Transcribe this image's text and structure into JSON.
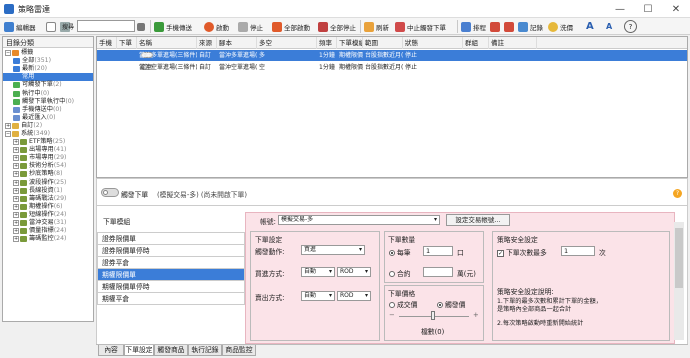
{
  "window": {
    "title": "策略雷達",
    "min": "—",
    "max": "☐",
    "close": "✕"
  },
  "toolbar": {
    "editor": "編輯器",
    "search_label": "搜尋",
    "search_value": "",
    "manual_send": "手機傳送",
    "start": "啟動",
    "stop": "停止",
    "start_all": "全部啟動",
    "stop_all": "全部停止",
    "refresh": "刷新",
    "suspend_trigger": "中止觸發下單",
    "schedule": "排程",
    "records": "記錄",
    "clear": "洗價",
    "font_up": "A",
    "font_down": "A",
    "help": "?"
  },
  "tree": {
    "header": "目錄分類",
    "items": [
      {
        "label": "標籤",
        "count": ""
      },
      {
        "label": "全部",
        "count": "(351)"
      },
      {
        "label": "最新",
        "count": "(20)"
      },
      {
        "label": "常用",
        "count": ""
      },
      {
        "label": "可觸發下單",
        "count": "(2)"
      },
      {
        "label": "執行中",
        "count": "(0)"
      },
      {
        "label": "觸發下單執行中",
        "count": "(0)"
      },
      {
        "label": "手機傳送中",
        "count": "(0)"
      },
      {
        "label": "最近匯入",
        "count": "(0)"
      },
      {
        "label": "自訂",
        "count": "(2)"
      },
      {
        "label": "系統",
        "count": "(349)"
      },
      {
        "label": "ETF策略",
        "count": "(25)"
      },
      {
        "label": "出場專用",
        "count": "(41)"
      },
      {
        "label": "市場專用",
        "count": "(29)"
      },
      {
        "label": "技術分析",
        "count": "(54)"
      },
      {
        "label": "抄底策略",
        "count": "(8)"
      },
      {
        "label": "波段操作",
        "count": "(25)"
      },
      {
        "label": "長線投資",
        "count": "(1)"
      },
      {
        "label": "籌碼戰法",
        "count": "(29)"
      },
      {
        "label": "期權操作",
        "count": "(6)"
      },
      {
        "label": "短線操作",
        "count": "(24)"
      },
      {
        "label": "當沖交易",
        "count": "(31)"
      },
      {
        "label": "價量指標",
        "count": "(24)"
      },
      {
        "label": "籌碼監控",
        "count": "(24)"
      }
    ]
  },
  "grid": {
    "headers": [
      "手機",
      "下單",
      "名稱",
      "來源",
      "腳本",
      "多空",
      "頻率",
      "下單模組",
      "範圍",
      "狀態",
      "群組",
      "備註"
    ],
    "rows": [
      {
        "name": "當沖多單進場(三條件)",
        "source": "自訂",
        "script": "當沖多單進場(三條件)",
        "dir": "多",
        "freq": "1分鐘",
        "module": "期權限價單",
        "range": "台股指數近月(FITXN*1)",
        "status": "停止"
      },
      {
        "name": "當沖空單進場(三條件)",
        "source": "自訂",
        "script": "當沖空單進場(三條件)",
        "dir": "空",
        "freq": "1分鐘",
        "module": "期權限價單",
        "range": "台股指數近月(FITXN*1)",
        "status": "停止"
      }
    ]
  },
  "trigger": {
    "label": "觸發下單",
    "mode": "(模擬交易-多) (尚未開啟下單)"
  },
  "order_panel": {
    "list_header": "下單模組",
    "modules": [
      "證券限價單",
      "證券限價單停時",
      "證券平倉",
      "期權限價單",
      "期權限價單停時",
      "期權平倉"
    ],
    "selected_module": 3,
    "account_label": "帳號:",
    "account_value": "模擬交易-多",
    "account_button": "設定交易帳號...",
    "order_settings": {
      "title": "下單設定",
      "action_label": "觸發動作:",
      "action_value": "買進",
      "buy_label": "買進方式:",
      "buy_value": "自動",
      "buy_type": "ROD",
      "sell_label": "賣出方式:",
      "sell_value": "自動",
      "sell_type": "ROD"
    },
    "qty": {
      "title": "下單數量",
      "per_label": "每筆",
      "per_value": "1",
      "per_unit": "口",
      "amount_label": "合約",
      "amount_unit": "萬(元)"
    },
    "price": {
      "title": "下單價格",
      "market_label": "成交價",
      "limit_label": "觸發價",
      "tick_label": "檔數(0)"
    },
    "safety": {
      "title": "策略安全設定",
      "max_label": "下單次數最多",
      "max_value": "1",
      "max_unit": "次",
      "desc_title": "策略安全設定說明:",
      "desc_1": "1.下單的最多次數和累計下單的金額，是策略內全部商品一起合計",
      "desc_2": "2.每次策略啟動時重新開始統計"
    }
  },
  "tabs": [
    "內容",
    "下單設定",
    "觸發商品",
    "執行記錄",
    "商品監控"
  ],
  "active_tab": 1
}
